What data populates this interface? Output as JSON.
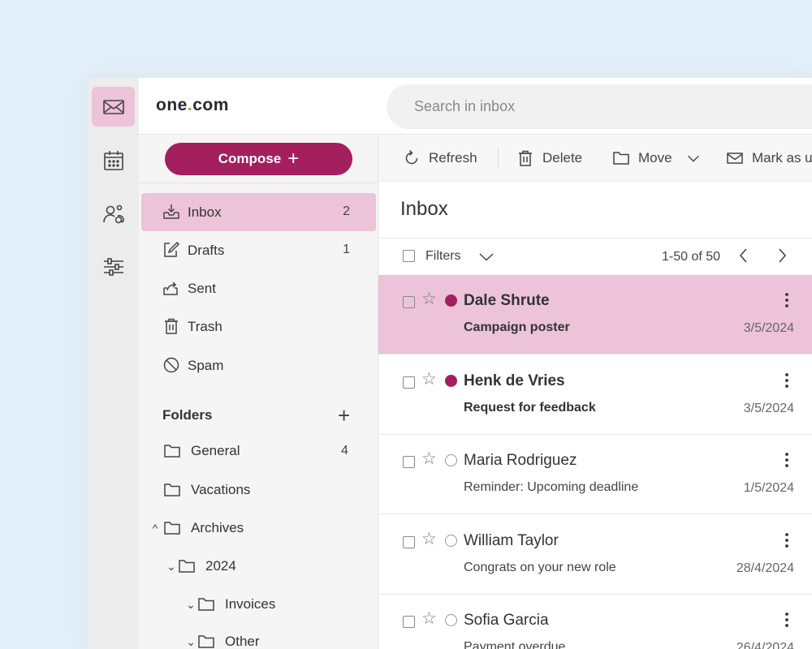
{
  "brand": {
    "name_prefix": "one",
    "name_dot": ".",
    "name_suffix": "com"
  },
  "search": {
    "placeholder": "Search in inbox"
  },
  "rail": {
    "items": [
      "mail-icon",
      "calendar-icon",
      "contacts-icon",
      "settings-sliders-icon"
    ],
    "active": "mail-icon"
  },
  "sidebar": {
    "compose_label": "Compose",
    "nav": [
      {
        "label": "Inbox",
        "count": "2",
        "icon": "inbox-icon",
        "active": true
      },
      {
        "label": "Drafts",
        "count": "1",
        "icon": "drafts-icon"
      },
      {
        "label": "Sent",
        "count": "",
        "icon": "sent-icon"
      },
      {
        "label": "Trash",
        "count": "",
        "icon": "trash-icon"
      },
      {
        "label": "Spam",
        "count": "",
        "icon": "spam-icon"
      }
    ],
    "folders_heading": "Folders",
    "folders": [
      {
        "label": "General",
        "count": "4"
      },
      {
        "label": "Vacations",
        "count": ""
      },
      {
        "label": "Archives",
        "count": "",
        "expanded": true
      },
      {
        "label": "2024",
        "count": "",
        "expanded": true
      },
      {
        "label": "Invoices",
        "count": "",
        "expanded": true
      },
      {
        "label": "Other",
        "count": "",
        "expanded": true
      }
    ]
  },
  "toolbar": {
    "refresh_label": "Refresh",
    "delete_label": "Delete",
    "move_label": "Move",
    "mark_label": "Mark as u"
  },
  "main": {
    "title": "Inbox",
    "filters_label": "Filters",
    "pager_text": "1-50 of 50"
  },
  "emails": [
    {
      "from": "Dale Shrute",
      "subject": "Campaign poster",
      "date": "3/5/2024",
      "unread": true,
      "selected": true
    },
    {
      "from": "Henk de Vries",
      "subject": "Request for feedback",
      "date": "3/5/2024",
      "unread": true,
      "selected": false
    },
    {
      "from": "Maria Rodriguez",
      "subject": "Reminder: Upcoming deadline",
      "date": "1/5/2024",
      "unread": false,
      "selected": false
    },
    {
      "from": "William Taylor",
      "subject": "Congrats on your new role",
      "date": "28/4/2024",
      "unread": false,
      "selected": false
    },
    {
      "from": "Sofia Garcia",
      "subject": "Payment overdue",
      "date": "26/4/2024",
      "unread": false,
      "selected": false
    }
  ],
  "colors": {
    "accent": "#a41f5e",
    "selected": "#ecc3d8",
    "logo_dot": "#78b83a",
    "background": "#e3eff8"
  }
}
